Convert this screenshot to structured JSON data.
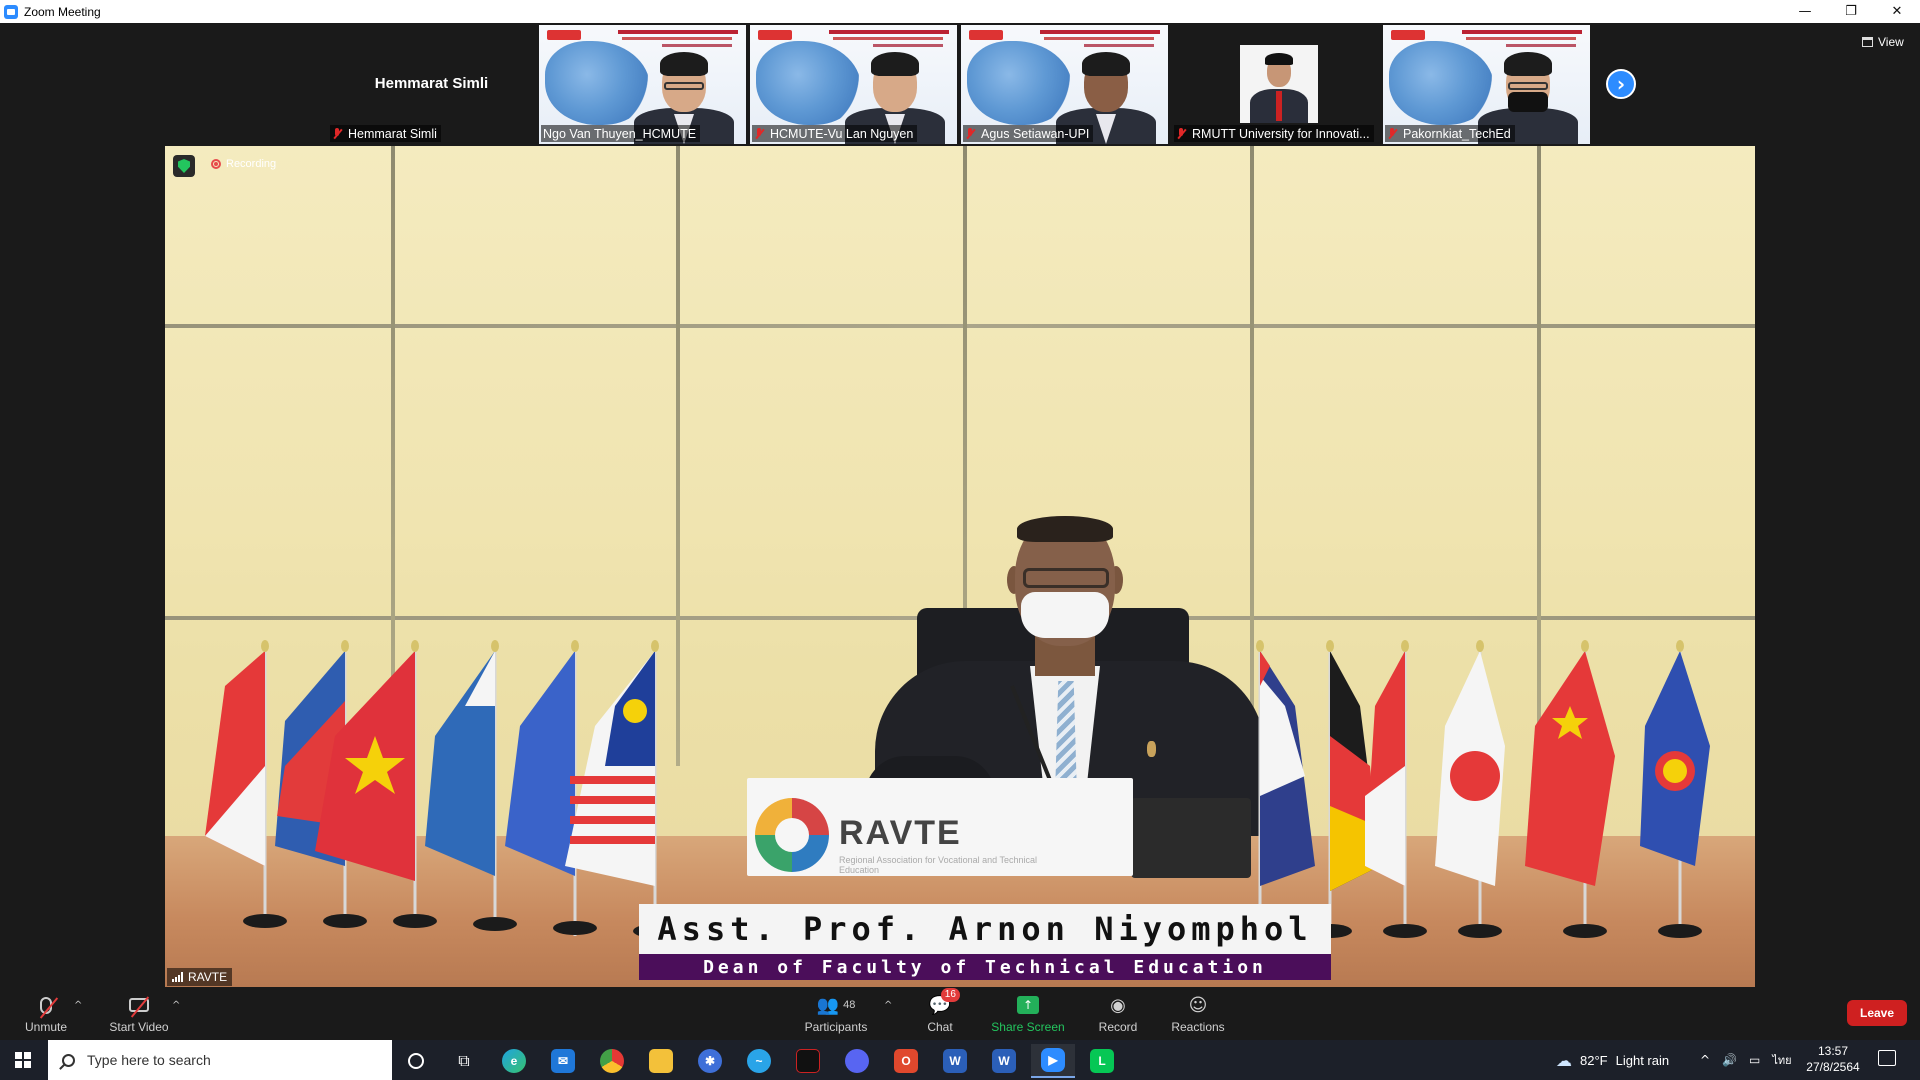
{
  "window": {
    "title": "Zoom Meeting",
    "controls": [
      "—",
      "❐",
      "✕"
    ]
  },
  "gallery": {
    "tiles": [
      {
        "name": "Hemmarat Simli",
        "big_name": "Hemmarat Simli",
        "muted": true,
        "video": false
      },
      {
        "name": "Ngo Van Thuyen_HCMUTE",
        "muted": false,
        "video": true
      },
      {
        "name": "HCMUTE-Vu Lan Nguyen",
        "muted": true,
        "video": true
      },
      {
        "name": "Agus Setiawan-UPI",
        "muted": true,
        "video": true
      },
      {
        "name": "RMUTT University for Innovati...",
        "muted": true,
        "video": false
      },
      {
        "name": "Pakornkiat_TechEd",
        "muted": true,
        "video": true
      }
    ],
    "next_icon": "›",
    "view_label": "View"
  },
  "main_video": {
    "recording_label": "Recording",
    "participant_label": "RAVTE",
    "nameplate_title": "RAVTE",
    "nameplate_subtitle": "Regional Association for Vocational and Technical Education",
    "caption_name": "Asst. Prof. Arnon Niyomphol",
    "caption_title": "Dean of Faculty of Technical Education"
  },
  "toolbar": {
    "unmute": "Unmute",
    "start_video": "Start Video",
    "participants": "Participants",
    "participants_count": "48",
    "chat": "Chat",
    "chat_badge": "16",
    "share_screen": "Share Screen",
    "record": "Record",
    "reactions": "Reactions",
    "leave": "Leave",
    "caret": "^"
  },
  "taskbar": {
    "search_placeholder": "Type here to search",
    "weather_temp": "82°F",
    "weather_desc": "Light rain",
    "lang": "ไทย",
    "time": "13:57",
    "date": "27/8/2564"
  },
  "colors": {
    "zoom_blue": "#2d8cff",
    "leave_red": "#cf2020",
    "share_green": "#23b05a",
    "caption_purple": "#4b0e5a"
  }
}
